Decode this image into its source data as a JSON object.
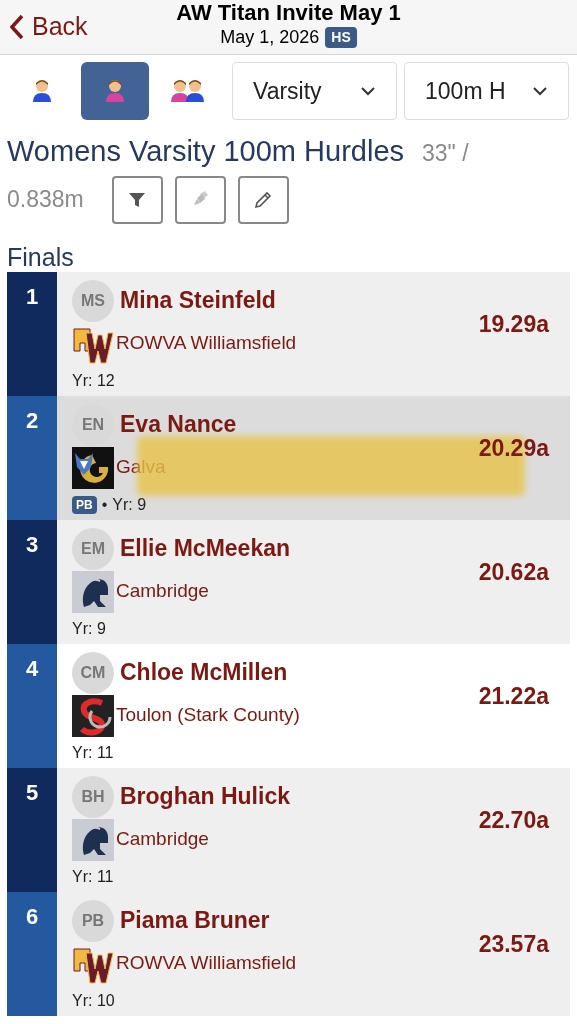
{
  "nav": {
    "back": "Back",
    "title": "AW Titan Invite May 1",
    "date": "May 1, 2026",
    "badge": "HS"
  },
  "gender_buttons": [
    {
      "kind": "boy",
      "selected": false
    },
    {
      "kind": "girl",
      "selected": true
    },
    {
      "kind": "both",
      "selected": false
    }
  ],
  "dropdowns": [
    {
      "value": "Varsity"
    },
    {
      "value": "100m H"
    }
  ],
  "event": {
    "title": "Womens Varsity 100m Hurdles",
    "spec": [
      "33\" /",
      "0.838m"
    ]
  },
  "tools": [
    {
      "kind": "filter"
    },
    {
      "kind": "highlighter"
    },
    {
      "kind": "pencil"
    }
  ],
  "section": "Finals",
  "results": [
    {
      "place": "1",
      "initials": "MS",
      "name": "Mina Steinfeld",
      "logo": {
        "kind": "rw"
      },
      "team": "ROWVA Williamsfield",
      "year": "Yr: 12",
      "mark": "19.29a",
      "selected": false,
      "highlighted": false
    },
    {
      "place": "2",
      "initials": "EN",
      "name": "Eva Nance",
      "logo": {
        "kind": "wildcat"
      },
      "team": "Galva",
      "pb": "PB",
      "separator": "•",
      "year": "Yr: 9",
      "mark": "20.29a",
      "selected": true,
      "highlighted": true
    },
    {
      "place": "3",
      "initials": "EM",
      "name": "Ellie McMeekan",
      "logo": {
        "kind": "spartan"
      },
      "team": "Cambridge",
      "year": "Yr: 9",
      "mark": "20.62a",
      "selected": false,
      "highlighted": false
    },
    {
      "place": "4",
      "initials": "CM",
      "name": "Chloe McMillen",
      "logo": {
        "kind": "sc"
      },
      "team": "Toulon (Stark County)",
      "year": "Yr: 11",
      "mark": "21.22a",
      "selected": false,
      "highlighted": false
    },
    {
      "place": "5",
      "initials": "BH",
      "name": "Broghan Hulick",
      "logo": {
        "kind": "spartan"
      },
      "team": "Cambridge",
      "year": "Yr: 11",
      "mark": "22.70a",
      "selected": false,
      "highlighted": false
    },
    {
      "place": "6",
      "initials": "PB",
      "name": "Piama Bruner",
      "logo": {
        "kind": "rw"
      },
      "team": "ROWVA Williamsfield",
      "year": "Yr: 10",
      "mark": "23.57a",
      "selected": false,
      "highlighted": false
    }
  ]
}
